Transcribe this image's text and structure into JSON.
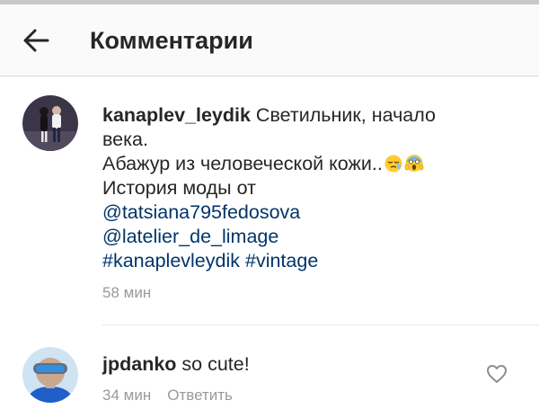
{
  "header": {
    "title": "Комментарии"
  },
  "comments": [
    {
      "username": "kanaplev_leydik",
      "line1": "Светильник, начало",
      "line2": "века.",
      "line3": "Абажур  из человеческой кожи..",
      "line4": "История моды от",
      "mention1": "@tatsiana795fedosova",
      "mention2": "@latelier_de_limage",
      "hashtag1": "#kanaplevleydik",
      "hashtag2": "#vintage",
      "time": "58 мин",
      "emojis": [
        "sleepy-face-emoji",
        "screaming-face-emoji"
      ]
    },
    {
      "username": "jpdanko",
      "text": "so cute!",
      "time": "34 мин",
      "reply_label": "Ответить"
    }
  ],
  "icons": {
    "back": "arrow-left-icon",
    "like": "heart-outline-icon"
  },
  "colors": {
    "link": "#003569",
    "meta": "#999999",
    "text": "#262626",
    "header_bg": "#fafafa"
  }
}
